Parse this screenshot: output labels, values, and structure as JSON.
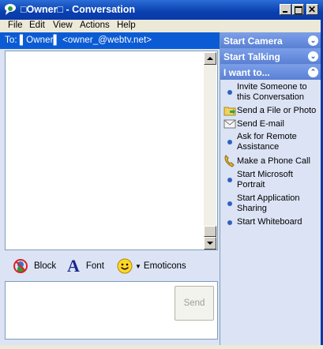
{
  "window": {
    "title": "□Owner□ - Conversation"
  },
  "menu": [
    "File",
    "Edit",
    "View",
    "Actions",
    "Help"
  ],
  "to_bar": {
    "text": "To:  ▌Owner▌ <owner_@webtv.net>"
  },
  "toolbar": {
    "block_label": "Block",
    "font_label": "Font",
    "emoticons_label": "Emoticons"
  },
  "send_label": "Send",
  "sections": {
    "camera": "Start Camera",
    "talking": "Start Talking",
    "iwant": "I want to..."
  },
  "tasks": [
    {
      "label": "Invite Someone to this Conversation",
      "icon": "bullet"
    },
    {
      "label": "Send a File or Photo",
      "icon": "folder-icon"
    },
    {
      "label": "Send E-mail",
      "icon": "envelope-icon"
    },
    {
      "label": "Ask for Remote Assistance",
      "icon": "bullet"
    },
    {
      "label": "Make a Phone Call",
      "icon": "phone-icon"
    },
    {
      "label": "Start Microsoft Portrait",
      "icon": "bullet"
    },
    {
      "label": "Start Application Sharing",
      "icon": "bullet"
    },
    {
      "label": "Start Whiteboard",
      "icon": "bullet"
    }
  ]
}
